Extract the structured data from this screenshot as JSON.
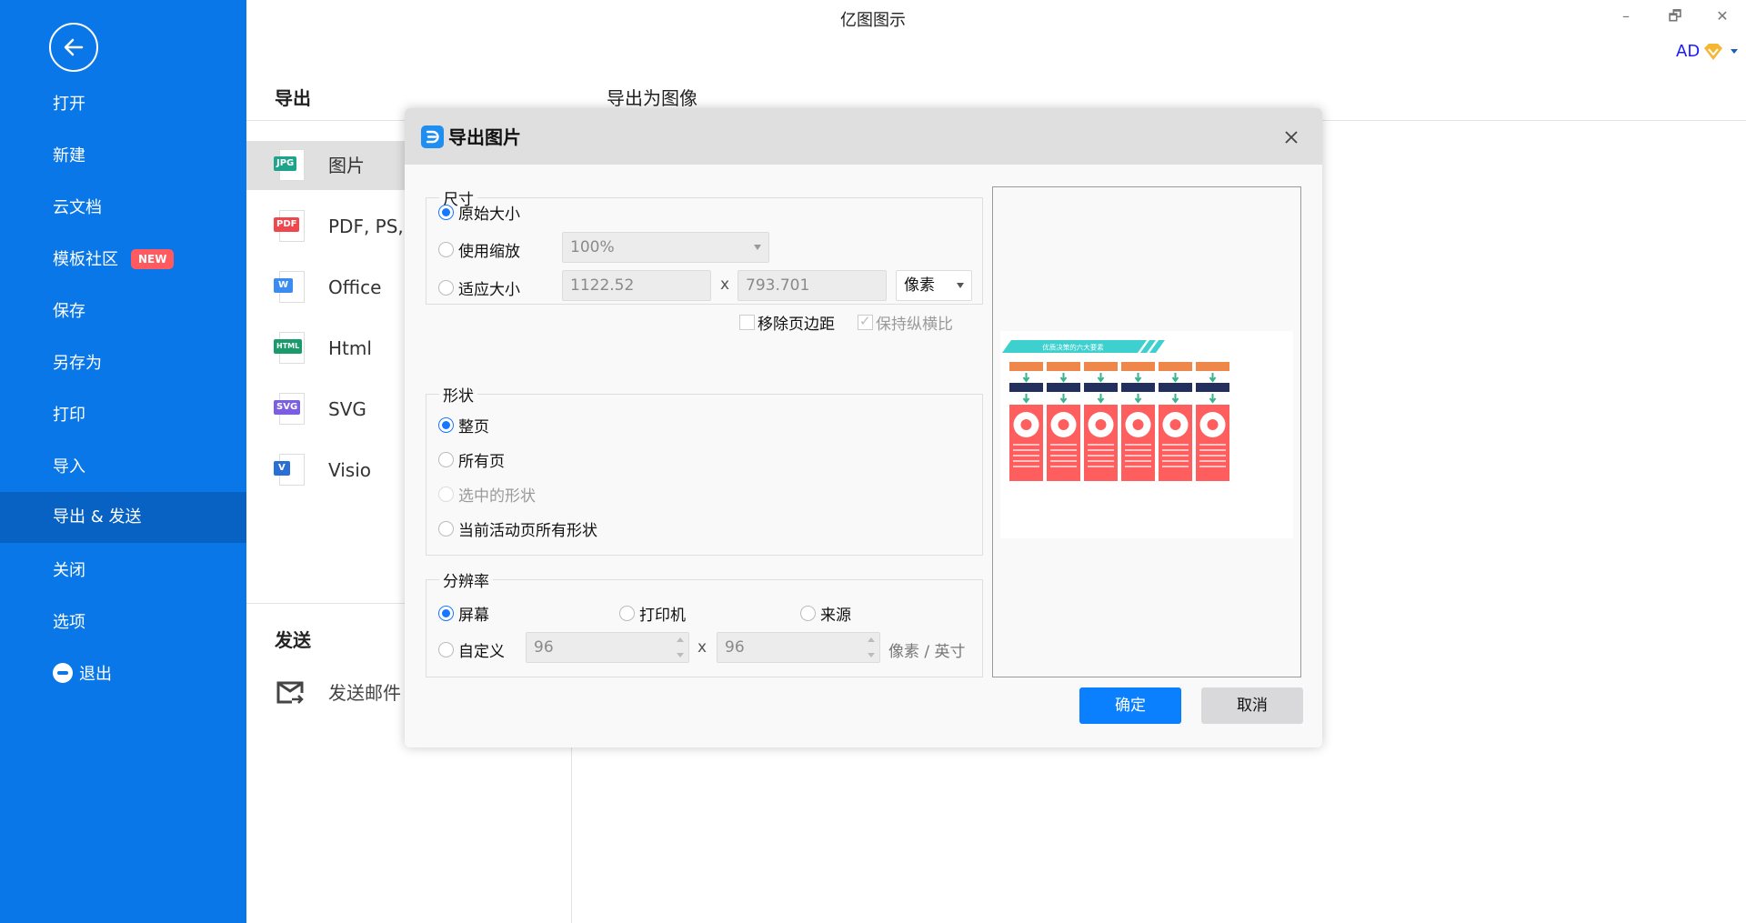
{
  "app": {
    "title": "亿图图示",
    "window_controls": {
      "minimize": "–",
      "restore": "🗗",
      "close": "✕"
    },
    "user": {
      "initials": "AD",
      "badge_icon": "vip-diamond-icon"
    }
  },
  "sidebar": {
    "back_icon": "back-arrow-icon",
    "items": [
      {
        "label": "打开"
      },
      {
        "label": "新建"
      },
      {
        "label": "云文档"
      },
      {
        "label": "模板社区",
        "badge": "NEW"
      },
      {
        "label": "保存"
      },
      {
        "label": "另存为"
      },
      {
        "label": "打印"
      },
      {
        "label": "导入"
      },
      {
        "label": "导出 & 发送",
        "active": true
      },
      {
        "label": "关闭"
      },
      {
        "label": "选项"
      },
      {
        "label": "退出",
        "icon": "exit-icon"
      }
    ]
  },
  "export_panel": {
    "heading": "导出",
    "subtitle": "导出为图像",
    "formats": [
      {
        "label": "图片",
        "tag": "JPG",
        "color": "#1fa38a",
        "active": true
      },
      {
        "label": "PDF, PS,",
        "tag": "PDF",
        "color": "#f0474f"
      },
      {
        "label": "Office",
        "tag": "W",
        "color": "#3b8cf0"
      },
      {
        "label": "Html",
        "tag": "HTML",
        "color": "#1a9b6b"
      },
      {
        "label": "SVG",
        "tag": "SVG",
        "color": "#7b5fe0"
      },
      {
        "label": "Visio",
        "tag": "V",
        "color": "#2a6fd6"
      }
    ],
    "send_heading": "发送",
    "send_items": [
      {
        "label": "发送邮件",
        "icon": "mail-send-icon"
      }
    ]
  },
  "dialog": {
    "title": "导出图片",
    "size_group": {
      "legend": "尺寸",
      "options": [
        {
          "label": "原始大小",
          "checked": true
        },
        {
          "label": "使用缩放",
          "checked": false
        },
        {
          "label": "适应大小",
          "checked": false
        }
      ],
      "zoom_value": "100%",
      "width_value": "1122.52",
      "height_value": "793.701",
      "times": "x",
      "unit_value": "像素",
      "remove_margin_label": "移除页边距",
      "remove_margin_checked": false,
      "keep_ratio_label": "保持纵横比",
      "keep_ratio_checked": true
    },
    "shape_group": {
      "legend": "形状",
      "options": [
        {
          "label": "整页",
          "checked": true,
          "disabled": false
        },
        {
          "label": "所有页",
          "checked": false,
          "disabled": false
        },
        {
          "label": "选中的形状",
          "checked": false,
          "disabled": true
        },
        {
          "label": "当前活动页所有形状",
          "checked": false,
          "disabled": false
        }
      ]
    },
    "resolution_group": {
      "legend": "分辨率",
      "options": [
        {
          "label": "屏幕",
          "checked": true
        },
        {
          "label": "打印机",
          "checked": false
        },
        {
          "label": "来源",
          "checked": false
        },
        {
          "label": "自定义",
          "checked": false
        }
      ],
      "dpi_x": "96",
      "dpi_y": "96",
      "times": "x",
      "unit_label": "像素 / 英寸"
    },
    "preview": {
      "title": "优质决策的六大要素",
      "column_icons": [
        "basket-icon",
        "umbrella-icon",
        "wifi-icon",
        "globe-icon",
        "whatsapp-icon",
        "user-icon"
      ],
      "colors": {
        "banner": "#3ecfcf",
        "top_box": "#f0874a",
        "mid_box": "#23305e",
        "arrow": "#3bb28f",
        "card": "#ff5e5e"
      }
    },
    "ok_label": "确定",
    "cancel_label": "取消"
  }
}
